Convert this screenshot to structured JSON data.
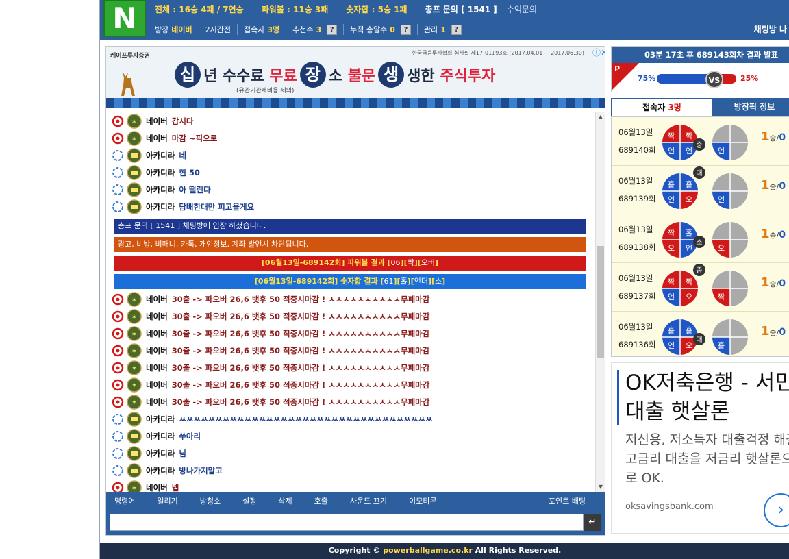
{
  "header": {
    "logo": "N",
    "stats": {
      "total": "전체 : 16승 4패 / 7연승",
      "powerball": "파워볼 : 11승 3패",
      "number_sum": "숫자합 : 5승 1패",
      "inquiry": "총프 문의 [ 1541 ]",
      "revenue_link": "수익문의"
    },
    "info": {
      "owner_label": "방장",
      "owner_value": "네이버",
      "duration": "2시간전",
      "users_label": "접속자",
      "users_value": "3명",
      "recommend_label": "추천수",
      "recommend_value": "3",
      "cumulative_label": "누적 총알수",
      "cumulative_value": "0",
      "manage_label": "관리",
      "manage_value": "1",
      "help": "?"
    },
    "chat_title": "채팅방 나"
  },
  "ad_banner": {
    "brand": "케이프투자증권",
    "disclaimer": "한국금융투자협회 심사필 제17-01193호 (2017.04.01 ~ 2017.06.30)",
    "c1": "십",
    "t1": "년 수수료",
    "t1r": "무료",
    "c2": "장",
    "t2": "소",
    "t2r": "불문",
    "c3": "생",
    "t3": "생한",
    "t3r": "주식투자",
    "sub": "(유관기관제비용 제외)",
    "close": "ⓘ✕"
  },
  "chat": {
    "messages": [
      {
        "nick": "네이버",
        "text": "갑시다",
        "kind": "naver"
      },
      {
        "nick": "네이버",
        "text": "마감 ~픽으로",
        "kind": "naver"
      },
      {
        "nick": "아카디라",
        "text": "네",
        "kind": "akadira"
      },
      {
        "nick": "아카디라",
        "text": "현 50",
        "kind": "akadira"
      },
      {
        "nick": "아카디라",
        "text": "아 떨린다",
        "kind": "akadira"
      },
      {
        "nick": "아카디라",
        "text": "담배한대만 피고올게요",
        "kind": "akadira"
      }
    ],
    "system_notices": {
      "enter": "총프 문의 [ 1541 ] 채팅방에 입장 하셨습니다.",
      "warning": "광고, 비방, 비매너, 카톡, 개인정보, 계좌 발언시 차단됩니다.",
      "pb_prefix": "[06월13일-689142회] 파워볼 결과 [",
      "pb_num": "06",
      "pb_mid": "][",
      "pb_a": "짝",
      "pb_b": "오버",
      "pb_end": "]",
      "ns_prefix": "[06월13일-689142회] 숫자합 결과 [",
      "ns_num": "61",
      "ns_a": "홀",
      "ns_b": "언더",
      "ns_c": "소",
      "ns_end": "]"
    },
    "messages2": [
      {
        "nick": "네이버",
        "text": "30출 ->   파오버 26,6   뱃후 50   적중시마감 ! ㅅㅅㅅㅅㅅㅅㅅㅅㅅㅅ무폐마감"
      },
      {
        "nick": "네이버",
        "text": "30출 ->   파오버 26,6   뱃후 50   적중시마감 ! ㅅㅅㅅㅅㅅㅅㅅㅅㅅㅅ무폐마감"
      },
      {
        "nick": "네이버",
        "text": "30출 ->   파오버 26,6   뱃후 50   적중시마감 ! ㅅㅅㅅㅅㅅㅅㅅㅅㅅㅅ무폐마감"
      },
      {
        "nick": "네이버",
        "text": "30출 ->   파오버 26,6   뱃후 50   적중시마감 ! ㅅㅅㅅㅅㅅㅅㅅㅅㅅㅅ무폐마감"
      },
      {
        "nick": "네이버",
        "text": "30출 ->   파오버 26,6   뱃후 50   적중시마감 ! ㅅㅅㅅㅅㅅㅅㅅㅅㅅㅅ무폐마감"
      },
      {
        "nick": "네이버",
        "text": "30출 ->   파오버 26,6   뱃후 50   적중시마감 ! ㅅㅅㅅㅅㅅㅅㅅㅅㅅㅅ무폐마감"
      },
      {
        "nick": "네이버",
        "text": "30출 ->   파오버 26,6   뱃후 50   적중시마감 ! ㅅㅅㅅㅅㅅㅅㅅㅅㅅㅅ무폐마감"
      }
    ],
    "messages3": [
      {
        "nick": "아카디라",
        "text": "ㅆㅆㅆㅆㅆㅆㅆㅆㅆㅆㅆㅆㅆㅆㅆㅆㅆㅆㅆㅆㅆㅆㅆㅆㅆㅆㅆㅆㅆㅆㅆㅆㅆㅆㅆ"
      },
      {
        "nick": "아카디라",
        "text": "쑤아리"
      },
      {
        "nick": "아카디라",
        "text": "님"
      },
      {
        "nick": "아카디라",
        "text": "방나가지말고"
      },
      {
        "nick": "네이버",
        "text": "넵"
      }
    ]
  },
  "command_bar": {
    "items": [
      "명령어",
      "얼리기",
      "방청소",
      "설정",
      "삭제",
      "호출",
      "사운드 끄기",
      "이모티콘"
    ],
    "point": "포인트 배팅"
  },
  "input": {
    "placeholder": "",
    "send_icon": "↵"
  },
  "result_box": {
    "title": "03분 17초 후 689143회차 결과 발표",
    "flag": "P",
    "left_pct": "75%",
    "right_pct": "25%",
    "left_fraction": 0.75,
    "vs": "VS"
  },
  "tabs": {
    "users_label": "접속자",
    "users_value": "3명",
    "owner_pick": "방장픽 정보"
  },
  "history": [
    {
      "date": "06월13일",
      "round": "689140회",
      "a": "짝",
      "b": "짝",
      "c": "언",
      "d": "언",
      "badge": "중",
      "result": "언",
      "win": "1",
      "unit": "승",
      "sep": "/",
      "loss": "0"
    },
    {
      "date": "06월13일",
      "round": "689139회",
      "a": "홀",
      "b": "홀",
      "c": "언",
      "d": "오",
      "badge": "대",
      "result": "언",
      "win": "1",
      "unit": "승",
      "sep": "/",
      "loss": "0"
    },
    {
      "date": "06월13일",
      "round": "689138회",
      "a": "짝",
      "b": "홀",
      "c": "오",
      "d": "언",
      "badge": "소",
      "result": "오",
      "win": "1",
      "unit": "승",
      "sep": "/",
      "loss": "0"
    },
    {
      "date": "06월13일",
      "round": "689137회",
      "a": "짝",
      "b": "짝",
      "c": "언",
      "d": "오",
      "badge": "중",
      "result": "짝",
      "win": "1",
      "unit": "승",
      "sep": "/",
      "loss": "0"
    },
    {
      "date": "06월13일",
      "round": "689136회",
      "a": "홀",
      "b": "홀",
      "c": "언",
      "d": "오",
      "badge": "대",
      "result": "홀",
      "win": "1",
      "unit": "승",
      "sep": "/",
      "loss": "0"
    }
  ],
  "ok_ad": {
    "title": "OK저축은행 - 서민대출 햇살론",
    "desc": "저신용, 저소득자 대출걱정 해결! 고금리 대출을 저금리 햇살론으로 OK.",
    "url": "oksavingsbank.com",
    "arrow": "›"
  },
  "footer": {
    "prefix": "Copyright © ",
    "domain": "powerballgame.co.kr",
    "suffix": " All Rights Reserved."
  },
  "colors": {
    "header_blue": "#2d5f9e",
    "logo_green": "#2ea82e",
    "highlight_yellow": "#ffd84a",
    "red": "#d01a1a",
    "blue": "#1f56c4",
    "orange": "#d2550f"
  }
}
